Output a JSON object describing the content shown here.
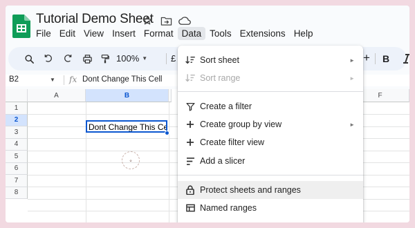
{
  "header": {
    "title": "Tutorial Demo Sheet",
    "menu": [
      "File",
      "Edit",
      "View",
      "Insert",
      "Format",
      "Data",
      "Tools",
      "Extensions",
      "Help"
    ],
    "active_menu": "Data"
  },
  "toolbar": {
    "zoom": "100%",
    "currency": "£",
    "plus": "+",
    "bold": "B"
  },
  "formula_bar": {
    "name_box": "B2",
    "fx": "fx",
    "content": "Dont Change This Cell"
  },
  "grid": {
    "columns": [
      "A",
      "B",
      "F"
    ],
    "rows": [
      "1",
      "2",
      "3",
      "4",
      "5",
      "6",
      "7",
      "8"
    ],
    "selected_cell": "B2",
    "selected_cell_value": "Dont Change This Cell"
  },
  "data_menu": {
    "items": [
      {
        "label": "Sort sheet",
        "icon": "sort-icon",
        "submenu": true,
        "disabled": false
      },
      {
        "label": "Sort range",
        "icon": "sort-icon",
        "submenu": true,
        "disabled": true
      },
      {
        "label": "Create a filter",
        "icon": "filter-icon",
        "submenu": false,
        "disabled": false
      },
      {
        "label": "Create group by view",
        "icon": "plus-icon",
        "submenu": true,
        "disabled": false
      },
      {
        "label": "Create filter view",
        "icon": "plus-icon",
        "submenu": false,
        "disabled": false
      },
      {
        "label": "Add a slicer",
        "icon": "slicer-icon",
        "submenu": false,
        "disabled": false
      },
      {
        "label": "Protect sheets and ranges",
        "icon": "lock-icon",
        "submenu": false,
        "disabled": false,
        "hovered": true
      },
      {
        "label": "Named ranges",
        "icon": "named-ranges-icon",
        "submenu": false,
        "disabled": false
      }
    ],
    "submenu_arrow": "►"
  },
  "colors": {
    "accent": "#0b57d0",
    "sheets_green": "#0f9d58",
    "selection_bg": "#d3e3fd",
    "page_bg": "#f2d9e1"
  }
}
